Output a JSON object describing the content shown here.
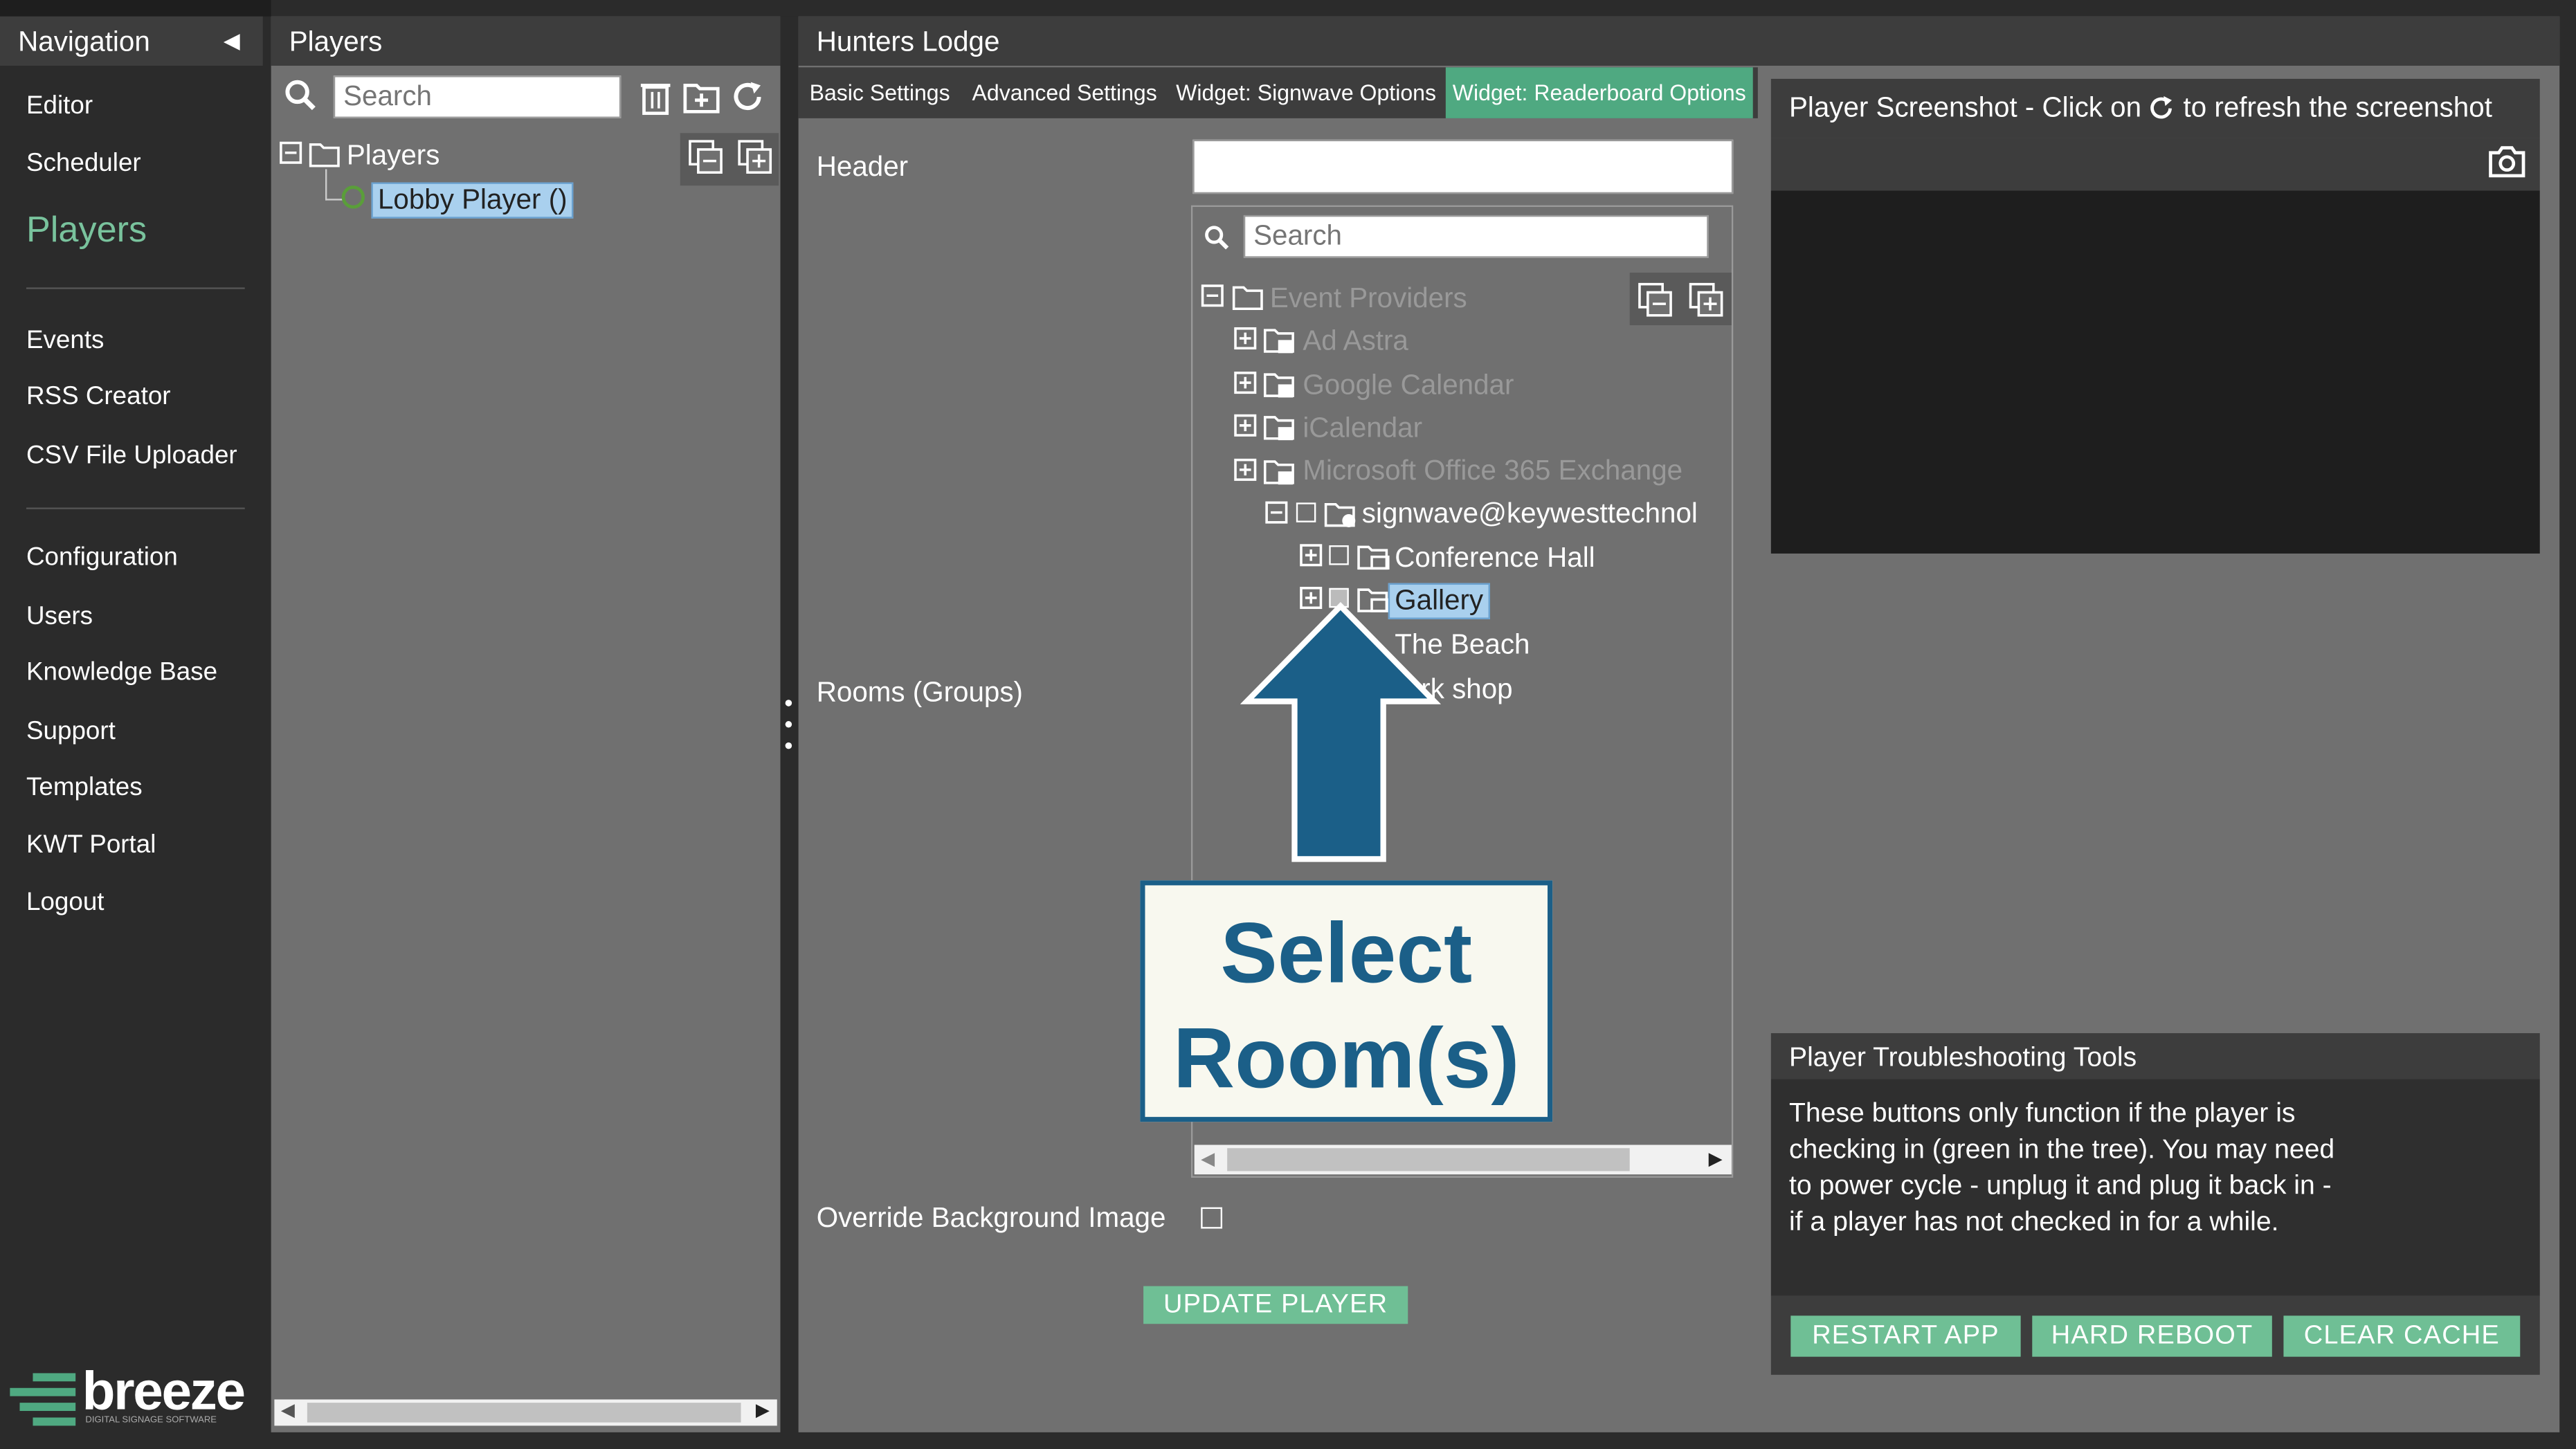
{
  "nav": {
    "title": "Navigation",
    "collapse_icon": "triangle-left-icon",
    "items": {
      "editor": "Editor",
      "scheduler": "Scheduler",
      "players": "Players",
      "events": "Events",
      "rss_creator": "RSS Creator",
      "csv_uploader": "CSV File Uploader",
      "configuration": "Configuration",
      "users": "Users",
      "knowledge_base": "Knowledge Base",
      "support": "Support",
      "templates": "Templates",
      "kwt_portal": "KWT Portal",
      "logout": "Logout"
    },
    "logo_text": "breeze",
    "logo_tagline": "DIGITAL SIGNAGE SOFTWARE"
  },
  "players_panel": {
    "title": "Players",
    "search_placeholder": "Search",
    "tree_root": "Players",
    "player": "Lobby Player ()"
  },
  "main": {
    "title": "Hunters Lodge",
    "tabs": [
      "Basic Settings",
      "Advanced Settings",
      "Widget: Signwave Options",
      "Widget: Readerboard Options"
    ],
    "active_tab": 3,
    "header_label": "Header",
    "header_value": "",
    "rooms_label": "Rooms (Groups)",
    "tree_search_placeholder": "Search",
    "tree": {
      "root": "Event Providers",
      "providers": [
        "Ad Astra",
        "Google Calendar",
        "iCalendar",
        "Microsoft Office 365 Exchange"
      ],
      "account": "signwave@keywesttechnol",
      "rooms": [
        "Conference Hall",
        "Gallery",
        "The Beach",
        "Work shop"
      ],
      "visible_rooms": [
        "Conference Hall",
        "Gallery",
        "The Beach",
        "rk shop"
      ],
      "selected_room": "Gallery"
    },
    "override_label": "Override Background Image",
    "update_button": "UPDATE PLAYER"
  },
  "screenshot": {
    "title_prefix": "Player Screenshot - Click on",
    "title_suffix": "to refresh the screenshot"
  },
  "troubleshooting": {
    "title": "Player Troubleshooting Tools",
    "text": "These buttons only function if the player is checking in (green in the tree). You may need to power cycle - unplug it and plug it back in - if a player has not checked in for a while.",
    "buttons": [
      "RESTART APP",
      "HARD REBOOT",
      "CLEAR CACHE"
    ]
  },
  "annotation": {
    "line1": "Select",
    "line2": "Room(s)",
    "arrow_color": "#1b5f88"
  },
  "colors": {
    "accent_green": "#4fa981",
    "active_nav": "#79c39d",
    "status_online": "#5a9e3a",
    "selection": "#a9d0ee"
  }
}
